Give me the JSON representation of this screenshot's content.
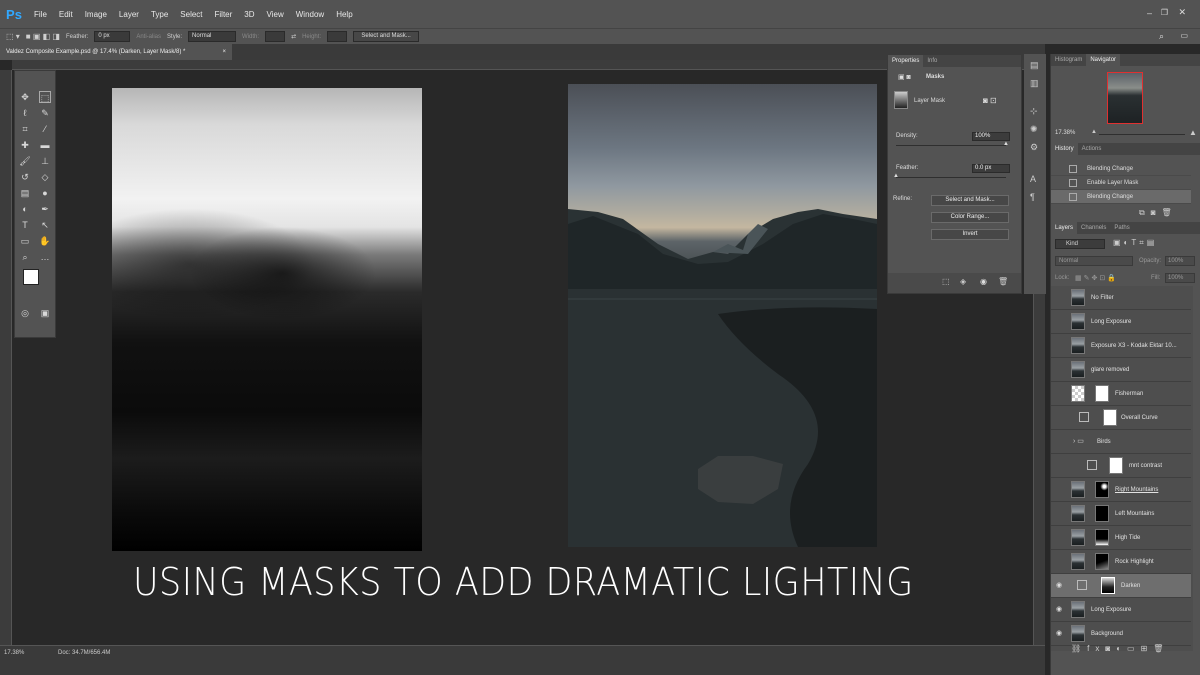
{
  "menubar": {
    "logo": "Ps",
    "items": [
      "File",
      "Edit",
      "Image",
      "Layer",
      "Type",
      "Select",
      "Filter",
      "3D",
      "View",
      "Window",
      "Help"
    ]
  },
  "options": {
    "feather_label": "Feather:",
    "feather_value": "0 px",
    "antialias_label": "Anti-alias",
    "style_label": "Style:",
    "style_value": "Normal",
    "width_label": "Width:",
    "height_label": "Height:",
    "select_mask_button": "Select and Mask..."
  },
  "document": {
    "tab_title": "Valdez Composite Example.psd @ 17.4% (Darken, Layer Mask/8) *",
    "close": "×"
  },
  "overlay_title": "USING MASKS TO ADD DRAMATIC LIGHTING",
  "status": {
    "zoom": "17.38%",
    "doc": "Doc: 34.7M/656.4M"
  },
  "properties": {
    "tabs": [
      "Properties",
      "Info"
    ],
    "section": "Masks",
    "layer_mask_label": "Layer Mask",
    "density_label": "Density:",
    "density_value": "100%",
    "feather_label": "Feather:",
    "feather_value": "0.0 px",
    "refine_label": "Refine:",
    "buttons": [
      "Select and Mask...",
      "Color Range...",
      "Invert"
    ]
  },
  "navigator": {
    "tabs": [
      "Histogram",
      "Navigator"
    ],
    "zoom": "17.38%"
  },
  "history": {
    "tabs": [
      "History",
      "Actions"
    ],
    "items": [
      "Blending Change",
      "Enable Layer Mask",
      "Blending Change"
    ]
  },
  "layers": {
    "tabs": [
      "Layers",
      "Channels",
      "Paths"
    ],
    "kind_label": "Kind",
    "blend_mode": "Normal",
    "opacity_label": "Opacity:",
    "opacity_value": "100%",
    "lock_label": "Lock:",
    "fill_label": "Fill:",
    "fill_value": "100%",
    "items": [
      {
        "name": "No Filter"
      },
      {
        "name": "Long Exposure"
      },
      {
        "name": "Exposure X3 - Kodak Ektar 10..."
      },
      {
        "name": "glare removed"
      },
      {
        "name": "Fisherman"
      },
      {
        "name": "Overall Curve"
      },
      {
        "name": "Birds"
      },
      {
        "name": "mnt contrast"
      },
      {
        "name": "Right Mountains"
      },
      {
        "name": "Left Mountains"
      },
      {
        "name": "High Tide"
      },
      {
        "name": "Rock Highlight"
      },
      {
        "name": "Darken"
      },
      {
        "name": "Long Exposure"
      },
      {
        "name": "Background"
      }
    ]
  }
}
